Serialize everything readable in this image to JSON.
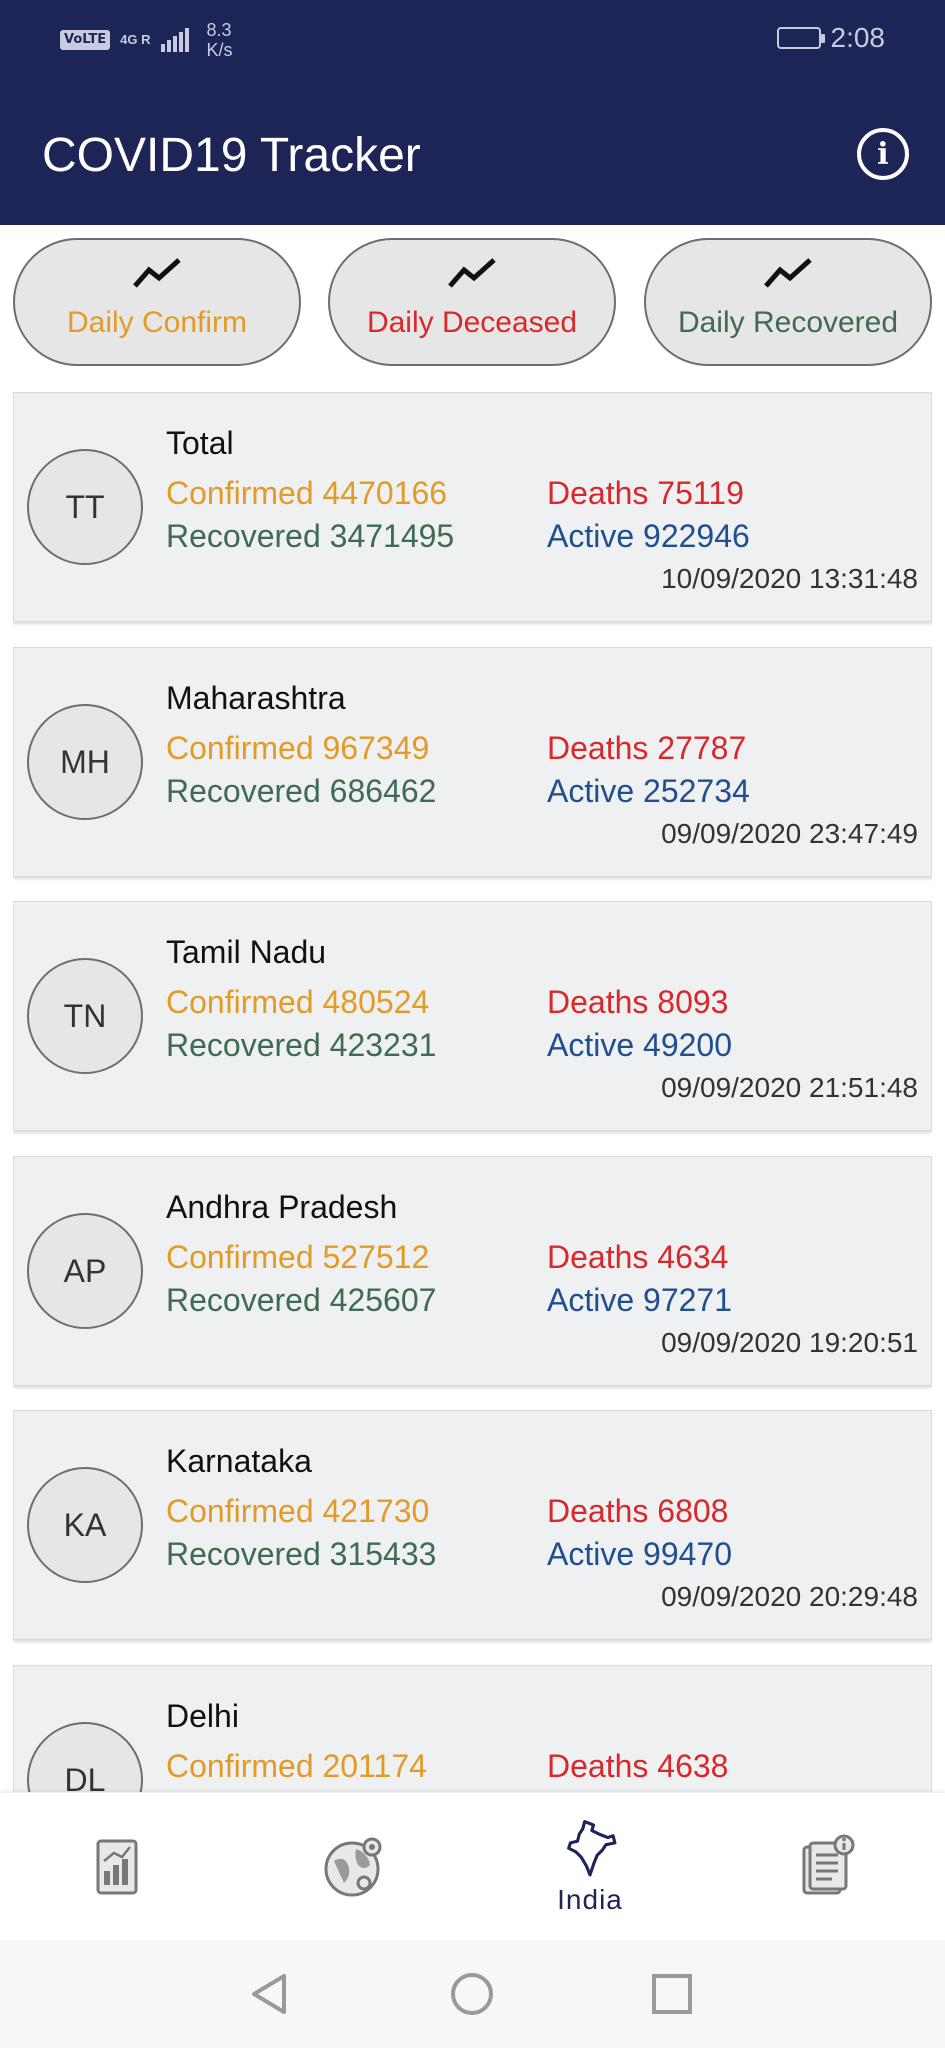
{
  "status_bar": {
    "volte": "VoLTE",
    "network": "4G R",
    "speed_value": "8.3",
    "speed_unit": "K/s",
    "time": "2:08"
  },
  "app_bar": {
    "title": "COVID19 Tracker",
    "info_icon": "info-icon"
  },
  "chart_buttons": [
    {
      "label": "Daily Confirm",
      "color": "#e39b25",
      "icon": "trend-icon"
    },
    {
      "label": "Daily Deceased",
      "color": "#d9282b",
      "icon": "trend-icon"
    },
    {
      "label": "Daily Recovered",
      "color": "#3f6b52",
      "icon": "trend-icon"
    }
  ],
  "states": [
    {
      "code": "TT",
      "name": "Total",
      "confirmed": "Confirmed 4470166",
      "deaths": "Deaths 75119",
      "recovered": "Recovered 3471495",
      "active": "Active 922946",
      "updated": "10/09/2020 13:31:48"
    },
    {
      "code": "MH",
      "name": "Maharashtra",
      "confirmed": "Confirmed 967349",
      "deaths": "Deaths 27787",
      "recovered": "Recovered 686462",
      "active": "Active 252734",
      "updated": "09/09/2020 23:47:49"
    },
    {
      "code": "TN",
      "name": "Tamil Nadu",
      "confirmed": "Confirmed 480524",
      "deaths": "Deaths 8093",
      "recovered": "Recovered 423231",
      "active": "Active 49200",
      "updated": "09/09/2020 21:51:48"
    },
    {
      "code": "AP",
      "name": "Andhra Pradesh",
      "confirmed": "Confirmed 527512",
      "deaths": "Deaths 4634",
      "recovered": "Recovered 425607",
      "active": "Active 97271",
      "updated": "09/09/2020 19:20:51"
    },
    {
      "code": "KA",
      "name": "Karnataka",
      "confirmed": "Confirmed 421730",
      "deaths": "Deaths 6808",
      "recovered": "Recovered 315433",
      "active": "Active 99470",
      "updated": "09/09/2020 20:29:48"
    },
    {
      "code": "DL",
      "name": "Delhi",
      "confirmed": "Confirmed 201174",
      "deaths": "Deaths 4638",
      "recovered": "",
      "active": "",
      "updated": ""
    }
  ],
  "bottom_nav": [
    {
      "icon": "report-chart-icon",
      "label": "",
      "active": false
    },
    {
      "icon": "globe-icon",
      "label": "",
      "active": false
    },
    {
      "icon": "india-map-icon",
      "label": "India",
      "active": true
    },
    {
      "icon": "news-info-icon",
      "label": "",
      "active": false
    }
  ],
  "colors": {
    "header_bg": "#1d2456",
    "confirmed": "#e39b25",
    "deaths": "#d9282b",
    "recovered": "#3f6b52",
    "active": "#1f4f8f"
  }
}
